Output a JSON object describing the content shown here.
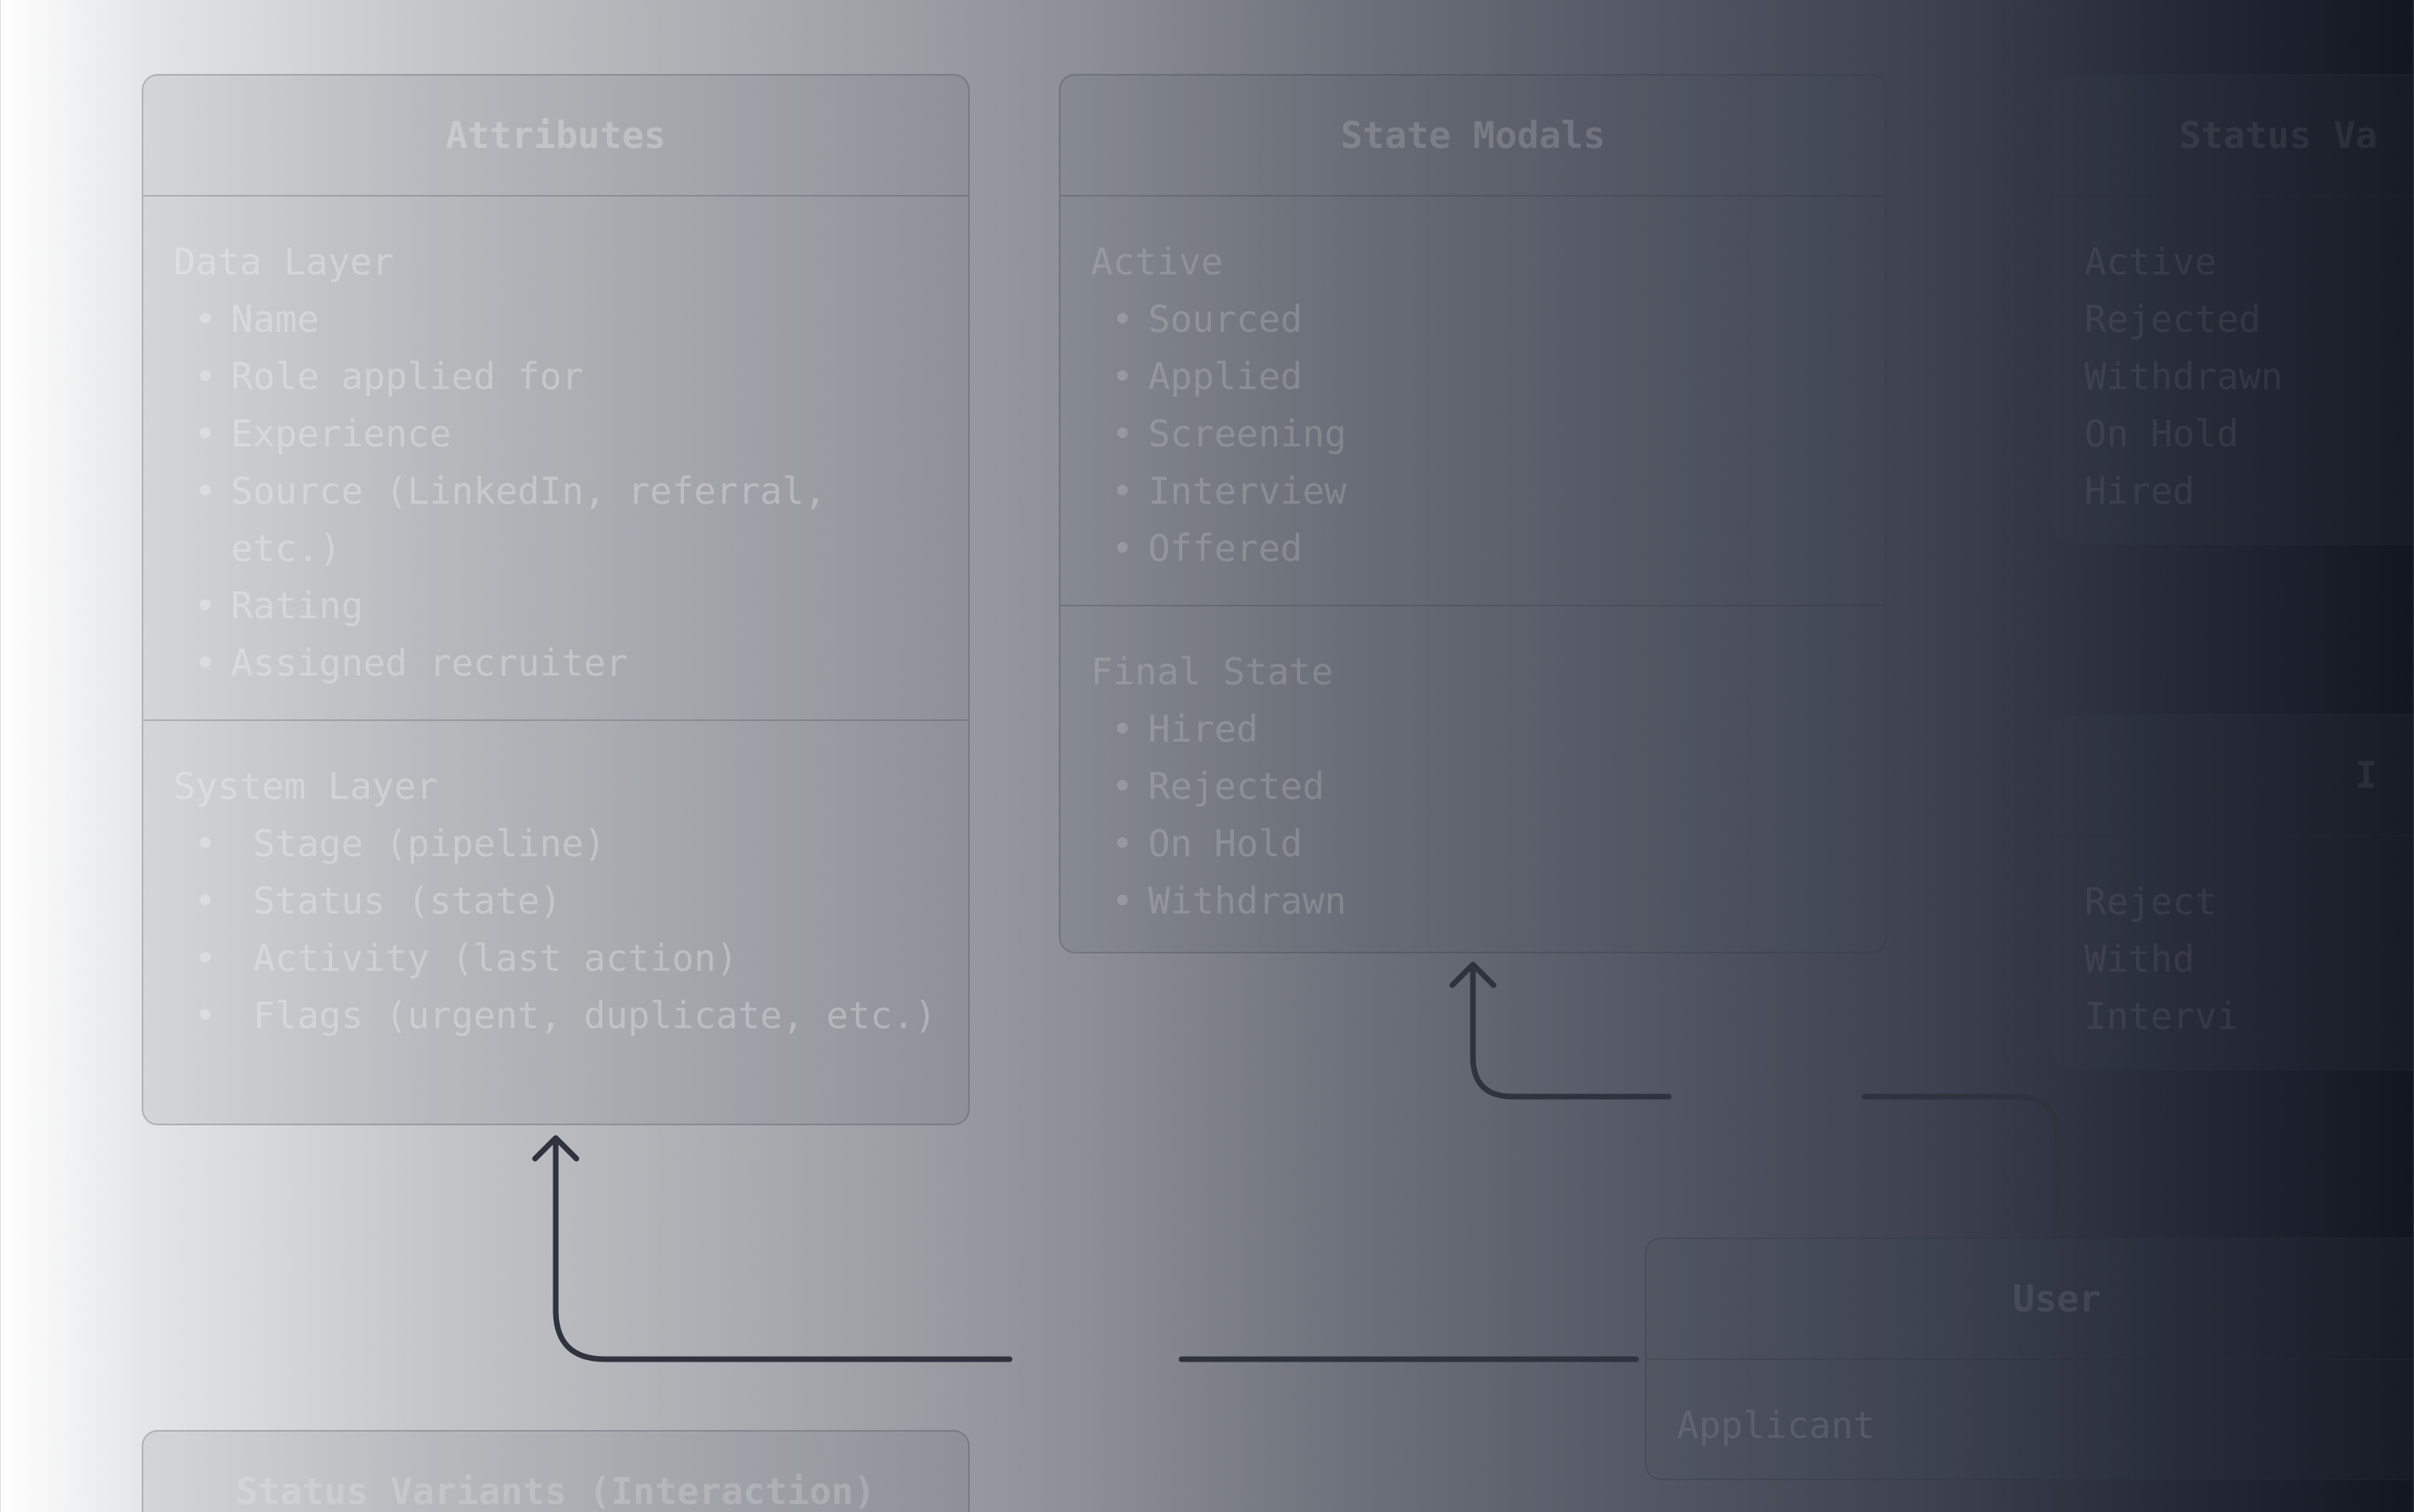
{
  "colors": {
    "connector": "#2e333d",
    "box_border": "#6a6e78",
    "text": "#ffffff"
  },
  "attributes": {
    "title": "Attributes",
    "data_layer": {
      "title": "Data Layer",
      "items": [
        "Name",
        "Role applied for",
        "Experience",
        "Source (LinkedIn, referral, etc.)",
        "Rating",
        "Assigned recruiter"
      ]
    },
    "system_layer": {
      "title": "System Layer",
      "items": [
        " Stage (pipeline)",
        " Status (state)",
        " Activity (last action)",
        " Flags (urgent, duplicate, etc.)"
      ]
    }
  },
  "state_modals": {
    "title": "State Modals",
    "active": {
      "title": "Active",
      "items": [
        "Sourced",
        "Applied",
        "Screening",
        "Interview",
        "Offered"
      ]
    },
    "final_state": {
      "title": "Final State",
      "items": [
        "Hired",
        "Rejected",
        "On Hold",
        "Withdrawn"
      ]
    }
  },
  "status_variants_right": {
    "title": "Status Va",
    "lines": [
      "Active",
      "Rejected",
      "Withdrawn",
      "On Hold",
      "Hired"
    ]
  },
  "partial_box": {
    "title": "I",
    "lines": [
      "Reject",
      "Withd",
      "Intervi"
    ]
  },
  "user": {
    "title": "User",
    "item": "Applicant"
  },
  "status_variants_bottom": {
    "title": "Status Variants (Interaction)"
  }
}
